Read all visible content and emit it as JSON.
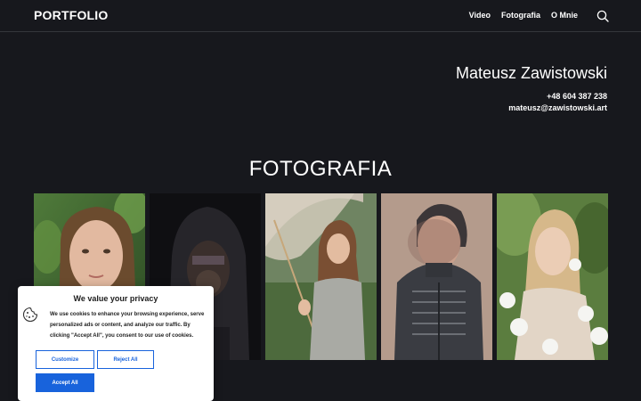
{
  "header": {
    "logo": "PORTFOLIO",
    "nav": [
      "Video",
      "Fotografia",
      "O Mnie"
    ],
    "search_icon": "search-icon"
  },
  "contact": {
    "name": "Mateusz Zawistowski",
    "phone": "+48 604 387 238",
    "email": "mateusz@zawistowski.art"
  },
  "section": {
    "title": "FOTOGRAFIA"
  },
  "gallery": {
    "photos": [
      {
        "subject": "young woman portrait among green leaves"
      },
      {
        "subject": "hooded figure in dark shadow"
      },
      {
        "subject": "woman with lace parasol and braids"
      },
      {
        "subject": "blurred man in dark jacket"
      },
      {
        "subject": "blonde woman among white flowers"
      }
    ]
  },
  "cookie_banner": {
    "title": "We value your privacy",
    "icon": "cookie-icon",
    "text": "We use cookies to enhance your browsing experience, serve personalized ads or content, and analyze our traffic. By clicking \"Accept All\", you consent to our use of cookies.",
    "customize": "Customize",
    "reject": "Reject All",
    "accept": "Accept All"
  },
  "colors": {
    "background": "#17181d",
    "accent": "#1863dc"
  }
}
